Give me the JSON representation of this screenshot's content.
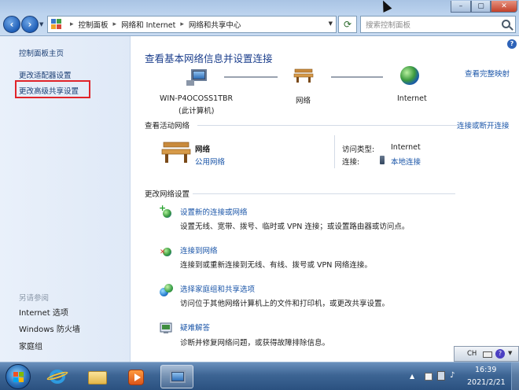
{
  "window": {
    "breadcrumbs": [
      "控制面板",
      "网络和 Internet",
      "网络和共享中心"
    ],
    "search_placeholder": "搜索控制面板"
  },
  "left_pane": {
    "home": "控制面板主页",
    "adapter_settings": "更改适配器设置",
    "advanced_sharing": "更改高级共享设置",
    "see_also_title": "另请参阅",
    "see_also": [
      "Internet 选项",
      "Windows 防火墙",
      "家庭组"
    ]
  },
  "main": {
    "title": "查看基本网络信息并设置连接",
    "full_map": "查看完整映射",
    "map": {
      "computer": "WIN-P4OCOSS1TBR",
      "computer_sub": "(此计算机)",
      "network": "网络",
      "internet": "Internet"
    },
    "active_networks": {
      "heading": "查看活动网络",
      "connect_link": "连接或断开连接",
      "network_name": "网络",
      "network_type": "公用网络",
      "access_type_label": "访问类型:",
      "access_type_value": "Internet",
      "connections_label": "连接:",
      "connections_value": "本地连接"
    },
    "change_settings": {
      "heading": "更改网络设置",
      "tasks": [
        {
          "link": "设置新的连接或网络",
          "desc": "设置无线、宽带、拨号、临时或 VPN 连接；或设置路由器或访问点。"
        },
        {
          "link": "连接到网络",
          "desc": "连接到或重新连接到无线、有线、拨号或 VPN 网络连接。"
        },
        {
          "link": "选择家庭组和共享选项",
          "desc": "访问位于其他网络计算机上的文件和打印机，或更改共享设置。"
        },
        {
          "link": "疑难解答",
          "desc": "诊断并修复网络问题，或获得故障排除信息。"
        }
      ]
    }
  },
  "language_bar": {
    "code": "CH"
  },
  "taskbar": {
    "time": "16:39",
    "date": "2021/2/21"
  },
  "colors": {
    "highlight_box": "#e0242a",
    "link": "#1a55a8",
    "title": "#1b3e8c"
  }
}
